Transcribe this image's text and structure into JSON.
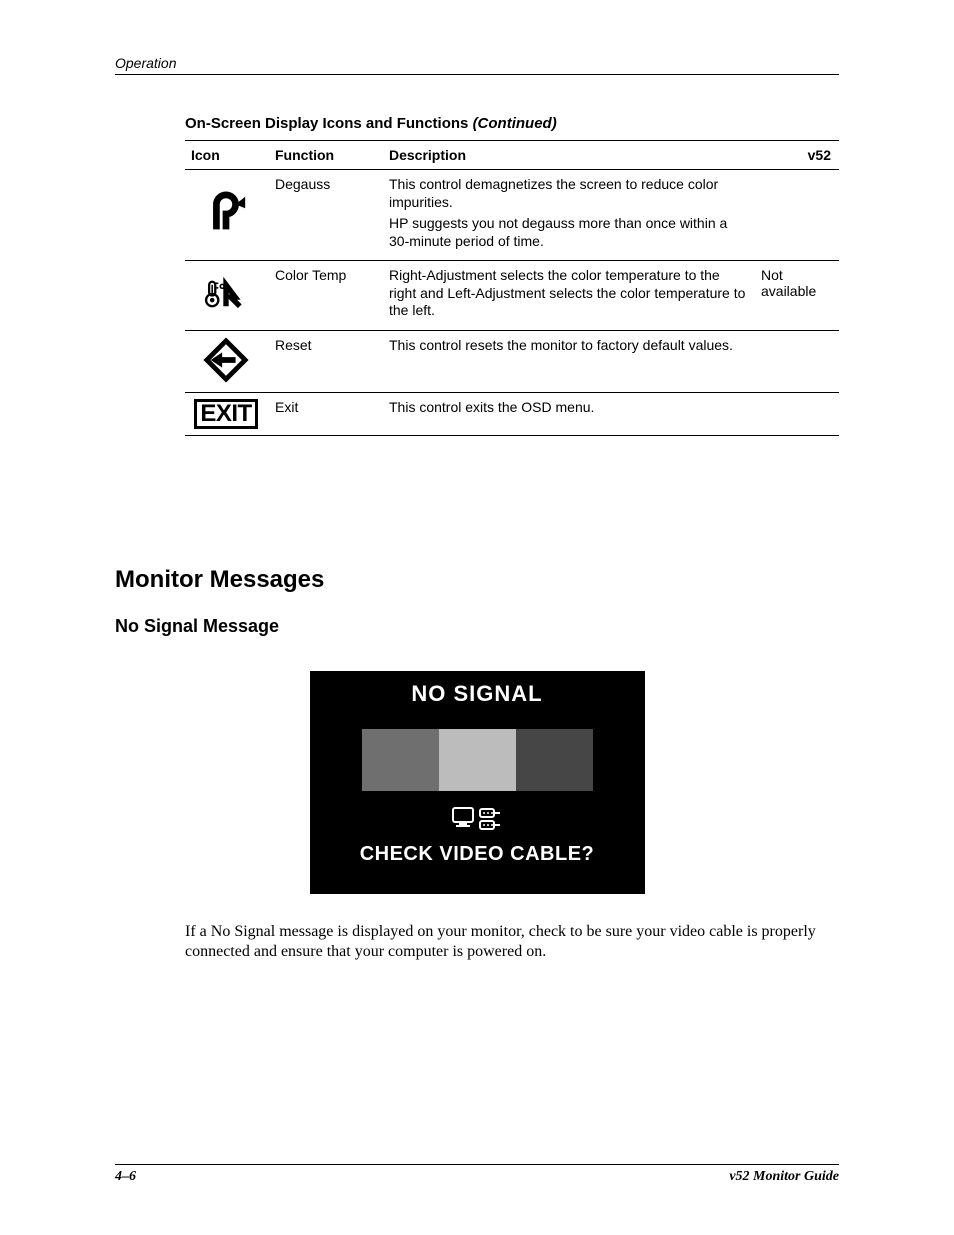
{
  "header": {
    "section": "Operation"
  },
  "table": {
    "title_main": "On-Screen Display Icons and Functions ",
    "title_cont": "(Continued)",
    "head": {
      "icon": "Icon",
      "func": "Function",
      "desc": "Description",
      "v52": "v52"
    },
    "rows": [
      {
        "func": "Degauss",
        "desc1": "This control demagnetizes the screen to reduce color impurities.",
        "desc2": "HP suggests you not degauss more than once within a 30-minute period of time.",
        "v52": ""
      },
      {
        "func": "Color Temp",
        "desc1": "Right-Adjustment selects the color temperature to the right and Left-Adjustment selects the color temperature to the left.",
        "desc2": "",
        "v52": "Not available"
      },
      {
        "func": "Reset",
        "desc1": "This control resets the monitor to factory default values.",
        "desc2": "",
        "v52": ""
      },
      {
        "func": "Exit",
        "desc1": "This control exits the OSD menu.",
        "desc2": "",
        "v52": ""
      }
    ],
    "exit_glyph": "EXIT"
  },
  "headings": {
    "h1": "Monitor Messages",
    "h2": "No Signal Message"
  },
  "nosignal": {
    "title": "NO SIGNAL",
    "message": "CHECK VIDEO CABLE?"
  },
  "caption": "If a No Signal message is displayed on your monitor, check to be sure your video cable is properly connected and ensure that your computer is powered on.",
  "footer": {
    "pagenum": "4–6",
    "guide": "v52 Monitor Guide"
  }
}
